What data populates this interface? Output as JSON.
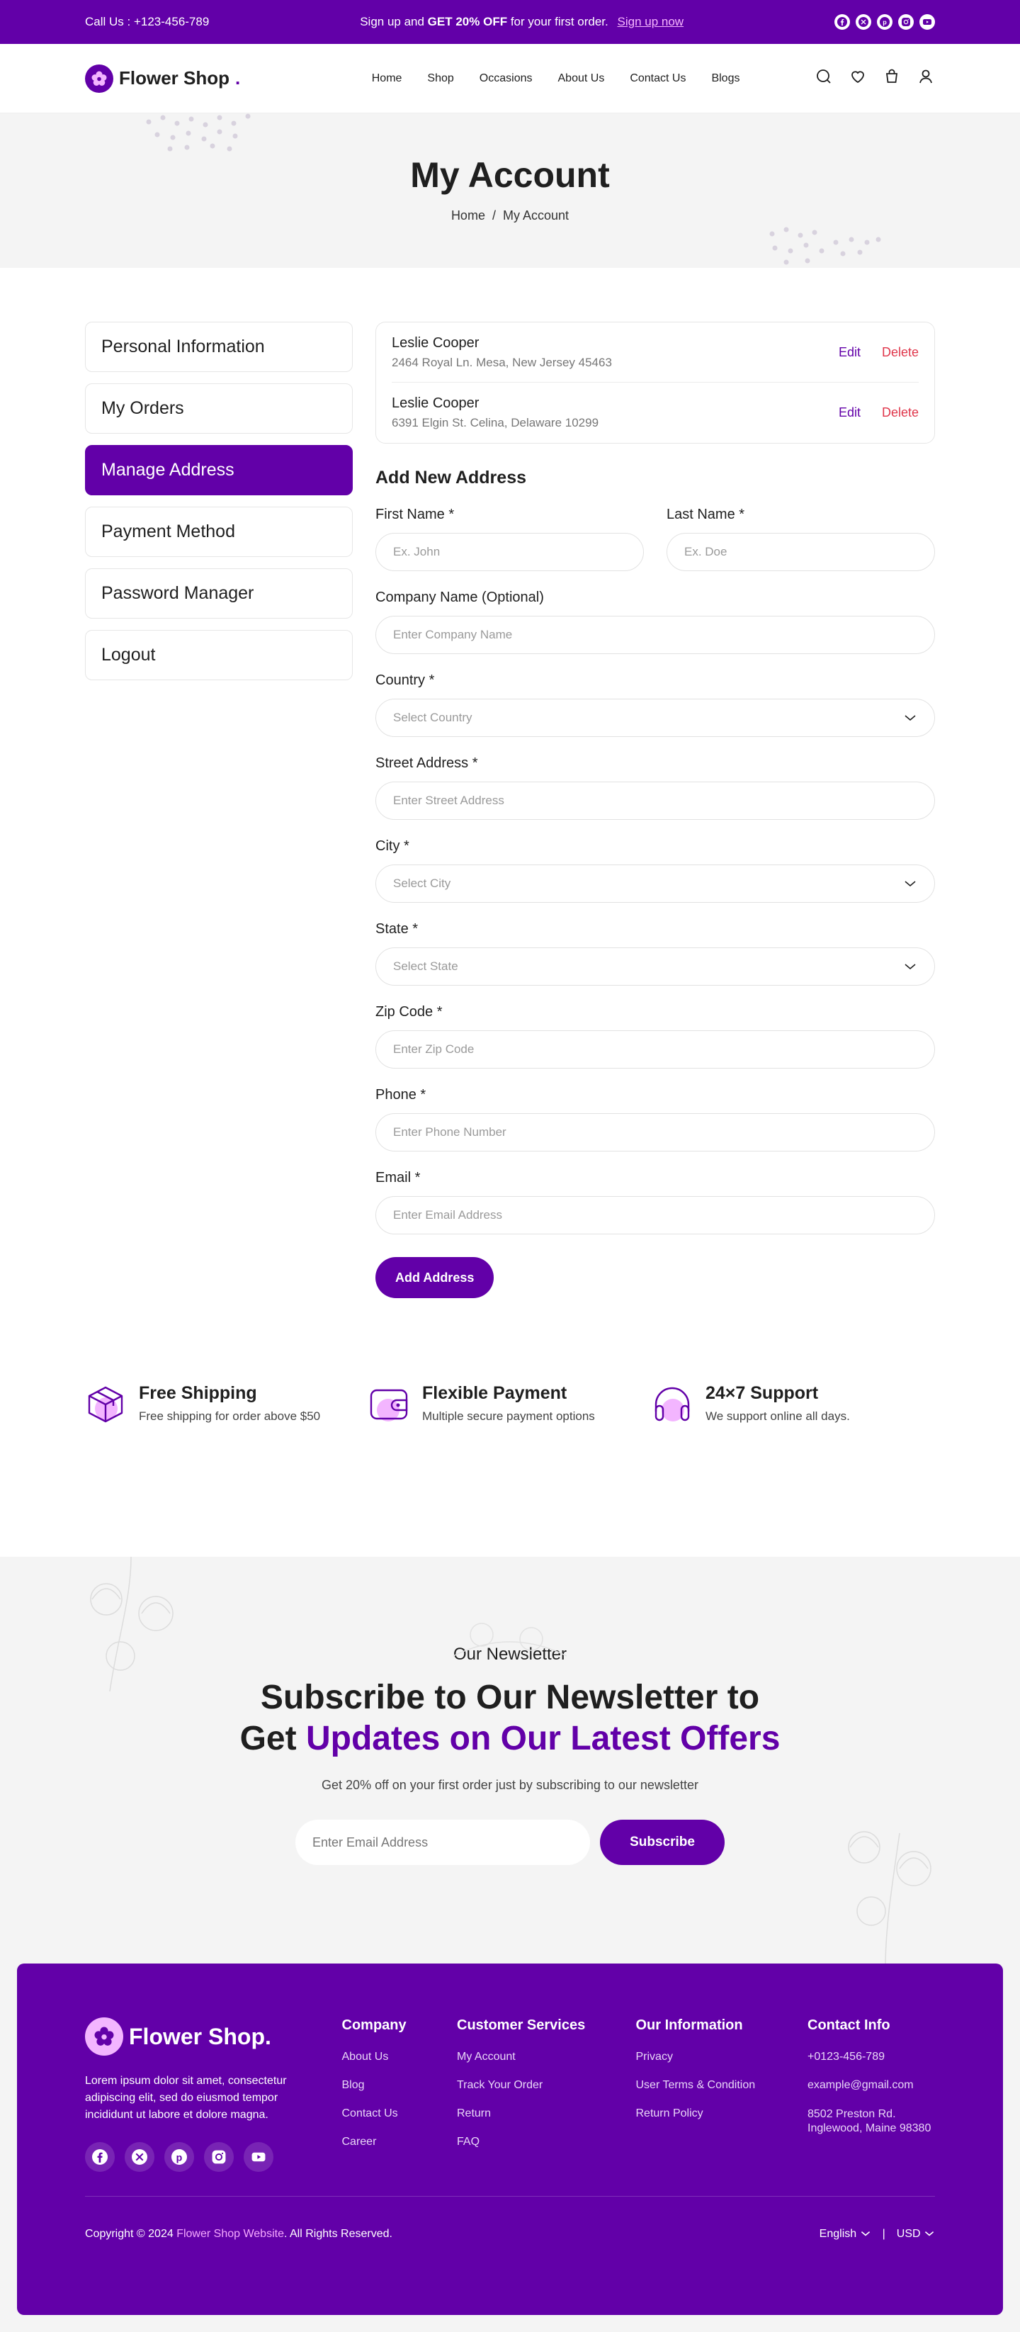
{
  "topbar": {
    "call": "Call Us :  +123-456-789",
    "promo_a": "Sign up and ",
    "promo_b": "GET 20% OFF",
    "promo_c": " for your first order.",
    "signup": "Sign up now"
  },
  "header": {
    "brand": "Flower Shop",
    "brand_dot": ".",
    "nav": [
      "Home",
      "Shop",
      "Occasions",
      "About Us",
      "Contact Us",
      "Blogs"
    ]
  },
  "hero": {
    "title": "My Account",
    "crumb_home": "Home",
    "crumb_sep": "/",
    "crumb_current": "My Account"
  },
  "sidebar": {
    "items": [
      "Personal Information",
      "My Orders",
      "Manage Address",
      "Payment Method",
      "Password Manager",
      "Logout"
    ],
    "active": "Manage Address"
  },
  "addresses": [
    {
      "name": "Leslie  Cooper",
      "address": "2464 Royal Ln. Mesa, New Jersey 45463",
      "edit": "Edit",
      "delete": "Delete"
    },
    {
      "name": "Leslie  Cooper",
      "address": "6391 Elgin St. Celina, Delaware 10299",
      "edit": "Edit",
      "delete": "Delete"
    }
  ],
  "form": {
    "title": "Add New Address",
    "first_name": {
      "label": "First Name *",
      "placeholder": "Ex. John"
    },
    "last_name": {
      "label": "Last Name *",
      "placeholder": "Ex. Doe"
    },
    "company": {
      "label": "Company Name (Optional)",
      "placeholder": "Enter Company Name"
    },
    "country": {
      "label": "Country *",
      "placeholder": "Select Country"
    },
    "street": {
      "label": "Street Address *",
      "placeholder": "Enter Street Address"
    },
    "city": {
      "label": "City *",
      "placeholder": "Select City"
    },
    "state": {
      "label": "State *",
      "placeholder": "Select State"
    },
    "zip": {
      "label": "Zip Code *",
      "placeholder": "Enter Zip Code"
    },
    "phone": {
      "label": "Phone *",
      "placeholder": "Enter Phone Number"
    },
    "email": {
      "label": "Email *",
      "placeholder": "Enter Email Address"
    },
    "submit": "Add Address"
  },
  "features": [
    {
      "icon": "box-icon",
      "title": "Free Shipping",
      "text": "Free shipping for order above $50"
    },
    {
      "icon": "wallet-icon",
      "title": "Flexible Payment",
      "text": "Multiple secure payment options"
    },
    {
      "icon": "headphones-icon",
      "title": "24×7 Support",
      "text": "We support online all days."
    }
  ],
  "newsletter": {
    "kicker": "Our Newsletter",
    "title_line1": "Subscribe to Our Newsletter to",
    "title_line2_a": "Get ",
    "title_line2_b": "Updates on Our Latest Offers",
    "sub": "Get 20% off on your first order just by subscribing to our newsletter",
    "placeholder": "Enter Email Address",
    "button": "Subscribe"
  },
  "footer": {
    "brand": "Flower Shop.",
    "about": "Lorem ipsum dolor sit amet, consectetur adipiscing elit, sed do eiusmod tempor incididunt ut labore et dolore magna.",
    "columns": [
      {
        "title": "Company",
        "links": [
          "About Us",
          "Blog",
          "Contact Us",
          "Career"
        ]
      },
      {
        "title": "Customer Services",
        "links": [
          "My Account",
          "Track Your Order",
          "Return",
          "FAQ"
        ]
      },
      {
        "title": "Our Information",
        "links": [
          "Privacy",
          "User Terms & Condition",
          "Return Policy"
        ]
      },
      {
        "title": "Contact Info",
        "links": [
          "+0123-456-789",
          "example@gmail.com",
          "8502 Preston Rd. Inglewood, Maine 98380"
        ]
      }
    ],
    "copy_a": "Copyright © 2024 ",
    "copy_b": "Flower Shop Website",
    "copy_c": ". All Rights Reserved.",
    "language": "English",
    "currency": "USD",
    "sep": "|"
  },
  "colors": {
    "primary": "#6200a8",
    "accent_pink": "#f3b5ff",
    "danger": "#e0364b"
  }
}
